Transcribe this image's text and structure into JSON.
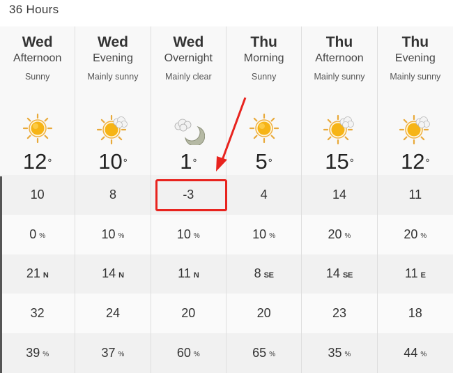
{
  "title": "36 Hours",
  "columns": [
    {
      "day": "Wed",
      "period": "Afternoon",
      "condition": "Sunny",
      "icon": "sun-icon",
      "temp": "12",
      "feels_like": "10",
      "pop": "0",
      "wind_speed": "21",
      "wind_dir": "N",
      "gust": "32",
      "humidity": "39"
    },
    {
      "day": "Wed",
      "period": "Evening",
      "condition": "Mainly sunny",
      "icon": "sun-cloud-icon",
      "temp": "10",
      "feels_like": "8",
      "pop": "10",
      "wind_speed": "14",
      "wind_dir": "N",
      "gust": "24",
      "humidity": "37"
    },
    {
      "day": "Wed",
      "period": "Overnight",
      "condition": "Mainly clear",
      "icon": "moon-cloud-icon",
      "temp": "1",
      "feels_like": "-3",
      "pop": "10",
      "wind_speed": "11",
      "wind_dir": "N",
      "gust": "20",
      "humidity": "60"
    },
    {
      "day": "Thu",
      "period": "Morning",
      "condition": "Sunny",
      "icon": "sun-icon",
      "temp": "5",
      "feels_like": "4",
      "pop": "10",
      "wind_speed": "8",
      "wind_dir": "SE",
      "gust": "20",
      "humidity": "65"
    },
    {
      "day": "Thu",
      "period": "Afternoon",
      "condition": "Mainly sunny",
      "icon": "sun-cloud-icon",
      "temp": "15",
      "feels_like": "14",
      "pop": "20",
      "wind_speed": "14",
      "wind_dir": "SE",
      "gust": "23",
      "humidity": "35"
    },
    {
      "day": "Thu",
      "period": "Evening",
      "condition": "Mainly sunny",
      "icon": "sun-cloud-icon",
      "temp": "12",
      "feels_like": "11",
      "pop": "20",
      "wind_speed": "11",
      "wind_dir": "E",
      "gust": "18",
      "humidity": "44"
    }
  ],
  "units": {
    "degree": "°",
    "percent": "%"
  },
  "annotation": {
    "highlight_color": "#e8231e",
    "highlighted_cell": "Wed Overnight feels-like -3"
  }
}
